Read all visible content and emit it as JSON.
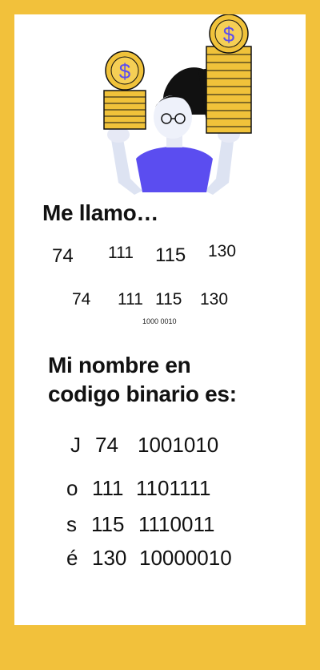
{
  "heading": "Me llamo…",
  "codes_row_1": [
    "74",
    "111",
    "115",
    "130"
  ],
  "codes_row_2": [
    "74",
    "111",
    "115",
    "130"
  ],
  "small_note": "1000 0010",
  "subheading_line1": "Mi nombre en",
  "subheading_line2": "codigo binario es:",
  "binary_table": [
    {
      "letter": "J",
      "code": "74",
      "binary": "1001010"
    },
    {
      "letter": "o",
      "code": "111",
      "binary": "1101111"
    },
    {
      "letter": "s",
      "code": "115",
      "binary": "1110011"
    },
    {
      "letter": "é",
      "code": "130",
      "binary": "10000010"
    }
  ],
  "colors": {
    "frame": "#f2c13b",
    "shirt": "#5b4df0",
    "coin": "#f0c23a",
    "hair": "#111111"
  },
  "icons": [
    "dollar-coin-icon",
    "dollar-coin-icon"
  ]
}
